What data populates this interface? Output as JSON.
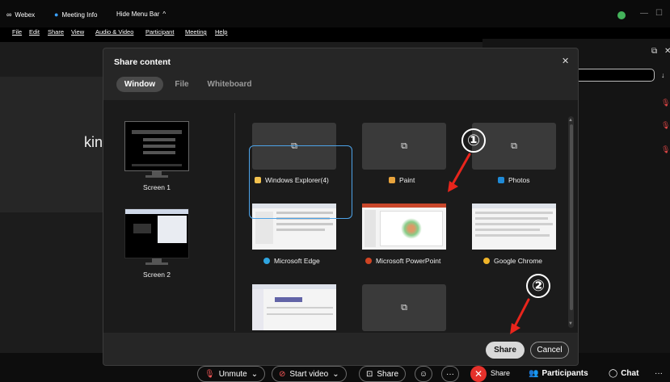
{
  "titlebar": {
    "app_name": "Webex",
    "meeting_info": "Meeting Info",
    "hide_menu_bar": "Hide Menu Bar",
    "hide_menu_chevron": "^"
  },
  "menubar": {
    "items": [
      "File",
      "Edit",
      "Share",
      "View",
      "Audio & Video",
      "Participant",
      "Meeting",
      "Help"
    ]
  },
  "video": {
    "participant_name_fragment": "kin"
  },
  "dialog": {
    "title": "Share content",
    "tabs": [
      "Window",
      "File",
      "Whiteboard"
    ],
    "active_tab": "Window",
    "screens": [
      {
        "label": "Screen 1"
      },
      {
        "label": "Screen 2"
      }
    ],
    "apps": [
      {
        "label": "Windows Explorer(4)",
        "color": "#f2c14e"
      },
      {
        "label": "Paint",
        "color": "#e8a33c"
      },
      {
        "label": "Photos",
        "color": "#1f8ad6"
      },
      {
        "label": "Microsoft Edge",
        "color": "#2fa5e0"
      },
      {
        "label": "Microsoft PowerPoint",
        "color": "#d04423",
        "selected": true
      },
      {
        "label": "Google Chrome",
        "color": "#f0b429"
      }
    ],
    "share_button": "Share",
    "cancel_button": "Cancel"
  },
  "callouts": {
    "first": "①",
    "second": "②"
  },
  "controls": {
    "unmute": "Unmute",
    "start_video": "Start video",
    "share": "Share",
    "share_status": "Share",
    "participants": "Participants",
    "chat": "Chat"
  },
  "colors": {
    "accent_blue": "#4da3e8",
    "end_red": "#e5312b",
    "mute_red": "#ff5a5a",
    "callout_arrow": "#e8251c"
  }
}
